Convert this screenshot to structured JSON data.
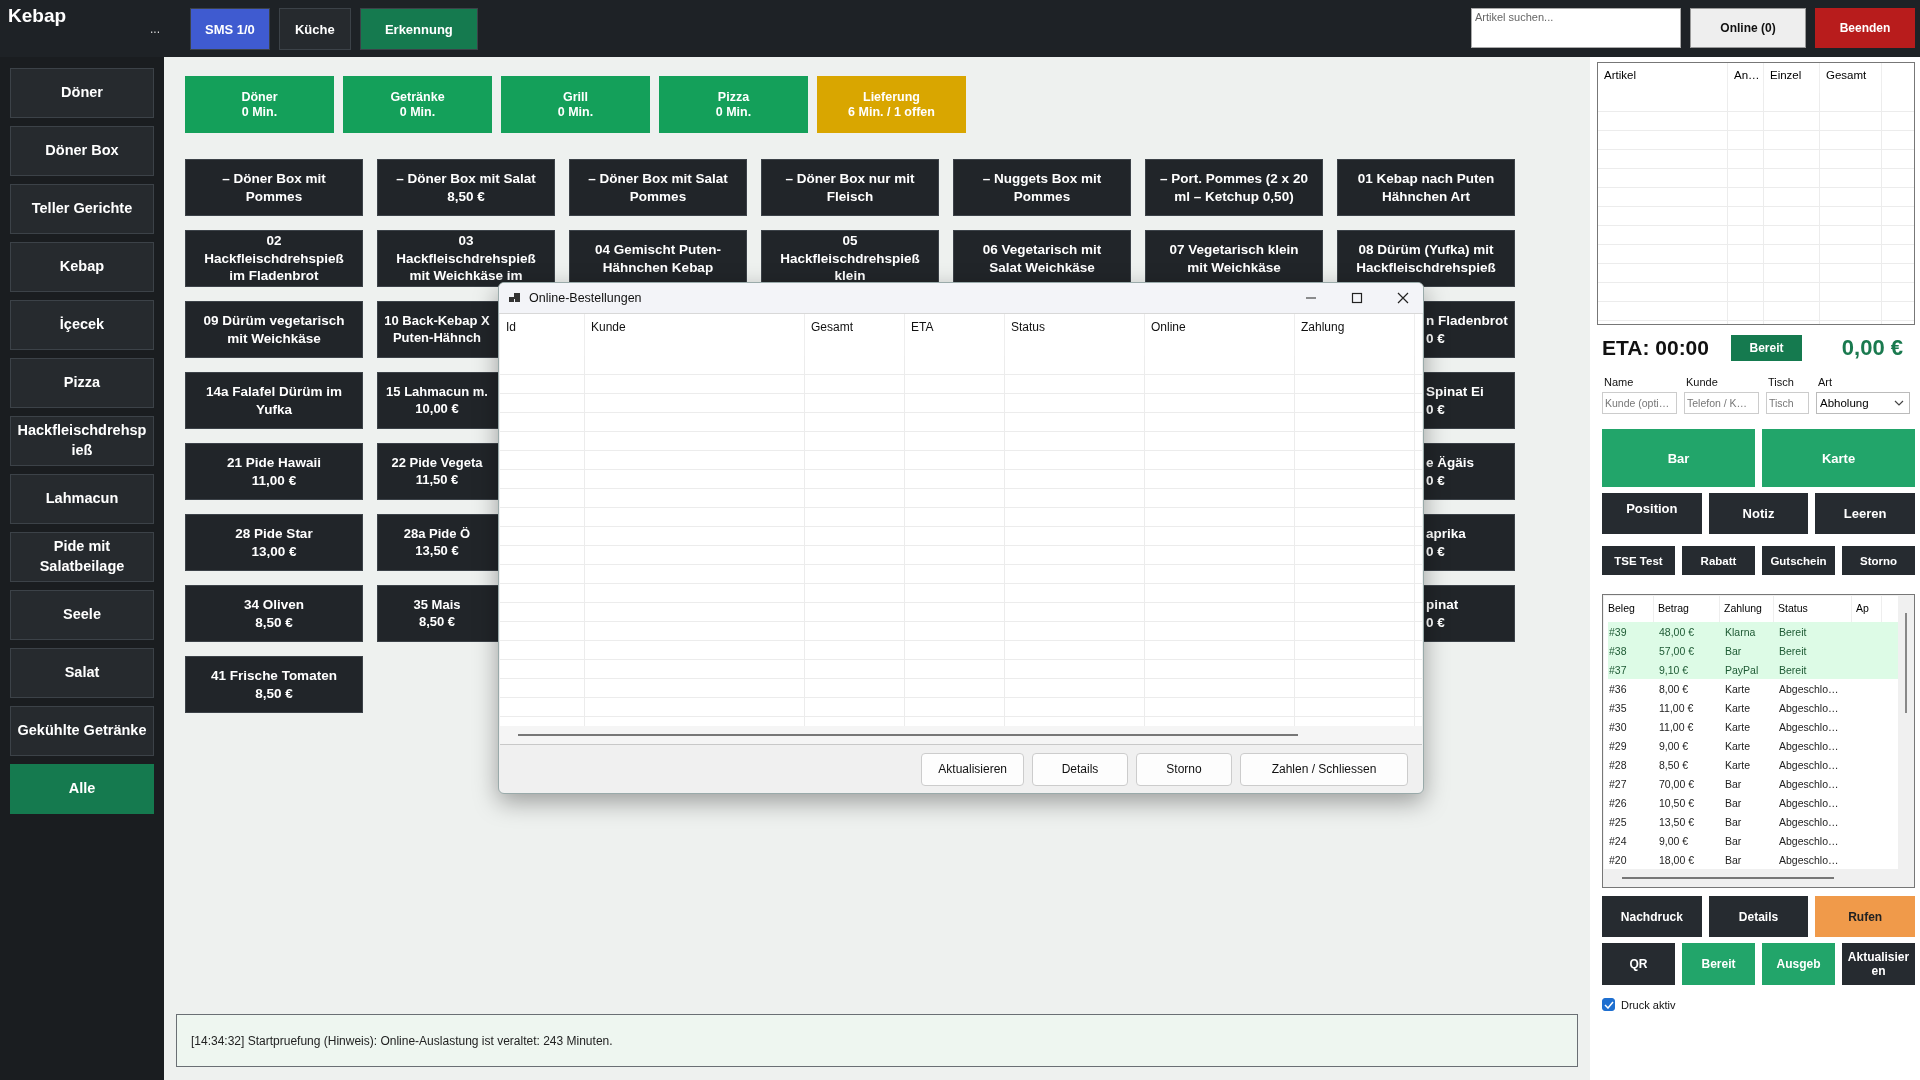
{
  "app": {
    "title": "Kebap",
    "more": "..."
  },
  "top_buttons": [
    {
      "label": "SMS 1/0",
      "kind": "blue"
    },
    {
      "label": "Küche",
      "kind": "dark"
    },
    {
      "label": "Erkennung",
      "kind": "green"
    }
  ],
  "search": {
    "placeholder": "Artikel suchen..."
  },
  "online_button": "Online (0)",
  "exit_button": "Beenden",
  "sidebar": {
    "items": [
      {
        "label": "Döner",
        "selected": false
      },
      {
        "label": "Döner Box",
        "selected": false
      },
      {
        "label": "Teller Gerichte",
        "selected": false
      },
      {
        "label": "Kebap",
        "selected": false
      },
      {
        "label": "İçecek",
        "selected": false
      },
      {
        "label": "Pizza",
        "selected": false
      },
      {
        "label": "Hackfleischdrehspieß",
        "selected": false
      },
      {
        "label": "Lahmacun",
        "selected": false
      },
      {
        "label": "Pide mit Salatbeilage",
        "selected": false
      },
      {
        "label": "Seele",
        "selected": false
      },
      {
        "label": "Salat",
        "selected": false
      },
      {
        "label": "Gekühlte Getränke",
        "selected": false
      },
      {
        "label": "Alle",
        "selected": true
      }
    ]
  },
  "stations": [
    {
      "name": "Döner",
      "time": "0 Min.",
      "kind": "ok"
    },
    {
      "name": "Getränke",
      "time": "0 Min.",
      "kind": "ok"
    },
    {
      "name": "Grill",
      "time": "0 Min.",
      "kind": "ok"
    },
    {
      "name": "Pizza",
      "time": "0 Min.",
      "kind": "ok"
    },
    {
      "name": "Lieferung",
      "time": "6 Min. / 1 offen",
      "kind": "busy"
    }
  ],
  "product_rows": [
    {
      "tiles": [
        {
          "name": "– Döner Box mit Pommes"
        },
        {
          "name": "– Döner Box mit Salat",
          "price": "8,50 €"
        },
        {
          "name": "– Döner Box mit Salat Pommes"
        },
        {
          "name": "– Döner Box nur mit Fleisch"
        },
        {
          "name": "– Nuggets Box mit Pommes"
        },
        {
          "name": "– Port. Pommes (2 x 20 ml – Ketchup 0,50)"
        },
        {
          "name": "01 Kebap nach Puten Hähnchen Art"
        }
      ]
    },
    {
      "tiles": [
        {
          "name": "02 Hackfleischdrehspieß im Fladenbrot"
        },
        {
          "name": "03 Hackfleischdrehspieß mit Weichkäse im"
        },
        {
          "name": "04 Gemischt Puten-Hähnchen Kebap"
        },
        {
          "name": "05 Hackfleischdrehspieß klein"
        },
        {
          "name": "06 Vegetarisch mit Salat Weichkäse"
        },
        {
          "name": "07 Vegetarisch klein mit Weichkäse"
        },
        {
          "name": "08 Dürüm (Yufka) mit Hackfleischdrehspieß"
        }
      ]
    },
    {
      "tiles": [
        {
          "name": "09 Dürüm vegetarisch mit Weichkäse"
        },
        {
          "name": "10 Back-Kebap X",
          "price": "Puten-Hähnch",
          "kind": "cut-right"
        },
        {
          "name": "n Fladenbrot",
          "price": "0 €",
          "kind": "cut-left"
        }
      ]
    },
    {
      "tiles": [
        {
          "name": "14a Falafel Dürüm im Yufka"
        },
        {
          "name": "15 Lahmacun m.",
          "price": "10,00 €",
          "kind": "cut-right"
        },
        {
          "name": "Spinat Ei",
          "price": "0 €",
          "kind": "cut-left"
        }
      ]
    },
    {
      "tiles": [
        {
          "name": "21 Pide Hawaii",
          "price": "11,00 €"
        },
        {
          "name": "22 Pide Vegeta",
          "price": "11,50 €",
          "kind": "cut-right"
        },
        {
          "name": "e Ägäis",
          "price": "0 €",
          "kind": "cut-left"
        }
      ]
    },
    {
      "tiles": [
        {
          "name": "28 Pide Star",
          "price": "13,00 €"
        },
        {
          "name": "28a Pide Ö",
          "price": "13,50 €",
          "kind": "cut-right"
        },
        {
          "name": "aprika",
          "price": "0 €",
          "kind": "cut-left"
        }
      ]
    },
    {
      "tiles": [
        {
          "name": "34 Oliven",
          "price": "8,50 €"
        },
        {
          "name": "35 Mais",
          "price": "8,50 €",
          "kind": "cut-right"
        },
        {
          "name": "pinat",
          "price": "0 €",
          "kind": "cut-left"
        }
      ]
    },
    {
      "tiles": [
        {
          "name": "41 Frische Tomaten",
          "price": "8,50 €"
        }
      ]
    }
  ],
  "status_message": "[14:34:32] Startpruefung (Hinweis): Online-Auslastung ist veraltet: 243 Minuten.",
  "dialog": {
    "title": "Online-Bestellungen",
    "columns": [
      "Id",
      "Kunde",
      "Gesamt",
      "ETA",
      "Status",
      "Online",
      "Zahlung"
    ],
    "buttons": [
      "Aktualisieren",
      "Details",
      "Storno",
      "Zahlen / Schliessen"
    ]
  },
  "order": {
    "columns": [
      "Artikel",
      "An…",
      "Einzel",
      "Gesamt"
    ],
    "eta": "ETA: 00:00",
    "ready_button": "Bereit",
    "total": "0,00 €",
    "fields": [
      {
        "label": "Name",
        "placeholder": "Kunde (opti…",
        "kind": "input"
      },
      {
        "label": "Kunde",
        "placeholder": "Telefon / K…",
        "kind": "input"
      },
      {
        "label": "Tisch",
        "placeholder": "Tisch",
        "kind": "input"
      },
      {
        "label": "Art",
        "value": "Abholung",
        "kind": "select"
      }
    ],
    "pay_buttons": [
      "Bar",
      "Karte"
    ],
    "action_buttons": [
      "Position",
      "Notiz",
      "Leeren"
    ],
    "small_buttons": [
      "TSE Test",
      "Rabatt",
      "Gutschein",
      "Storno"
    ]
  },
  "history": {
    "columns": [
      "Beleg",
      "Betrag",
      "Zahlung",
      "Status",
      "Ap"
    ],
    "rows": [
      {
        "beleg": "#39",
        "betrag": "48,00 €",
        "zahlung": "Klarna",
        "status": "Bereit",
        "highlighted": true
      },
      {
        "beleg": "#38",
        "betrag": "57,00 €",
        "zahlung": "Bar",
        "status": "Bereit",
        "highlighted": true
      },
      {
        "beleg": "#37",
        "betrag": "9,10 €",
        "zahlung": "PayPal",
        "status": "Bereit",
        "highlighted": true
      },
      {
        "beleg": "#36",
        "betrag": "8,00 €",
        "zahlung": "Karte",
        "status": "Abgeschlo…",
        "highlighted": false
      },
      {
        "beleg": "#35",
        "betrag": "11,00 €",
        "zahlung": "Karte",
        "status": "Abgeschlo…",
        "highlighted": false
      },
      {
        "beleg": "#30",
        "betrag": "11,00 €",
        "zahlung": "Karte",
        "status": "Abgeschlo…",
        "highlighted": false
      },
      {
        "beleg": "#29",
        "betrag": "9,00 €",
        "zahlung": "Karte",
        "status": "Abgeschlo…",
        "highlighted": false
      },
      {
        "beleg": "#28",
        "betrag": "8,50 €",
        "zahlung": "Karte",
        "status": "Abgeschlo…",
        "highlighted": false
      },
      {
        "beleg": "#27",
        "betrag": "70,00 €",
        "zahlung": "Bar",
        "status": "Abgeschlo…",
        "highlighted": false
      },
      {
        "beleg": "#26",
        "betrag": "10,50 €",
        "zahlung": "Bar",
        "status": "Abgeschlo…",
        "highlighted": false
      },
      {
        "beleg": "#25",
        "betrag": "13,50 €",
        "zahlung": "Bar",
        "status": "Abgeschlo…",
        "highlighted": false
      },
      {
        "beleg": "#24",
        "betrag": "9,00 €",
        "zahlung": "Bar",
        "status": "Abgeschlo…",
        "highlighted": false
      },
      {
        "beleg": "#20",
        "betrag": "18,00 €",
        "zahlung": "Bar",
        "status": "Abgeschlo…",
        "highlighted": false
      }
    ]
  },
  "history_buttons": [
    {
      "label": "Nachdruck",
      "kind": "dark"
    },
    {
      "label": "Details",
      "kind": "dark"
    },
    {
      "label": "Rufen",
      "kind": "orange"
    },
    {
      "label": "QR",
      "kind": "dark"
    },
    {
      "label": "Bereit",
      "kind": "green"
    },
    {
      "label": "Ausgeb",
      "kind": "green"
    },
    {
      "label": "Aktualisieren",
      "kind": "dark"
    }
  ],
  "print_toggle": {
    "label": "Druck aktiv",
    "checked": true
  }
}
